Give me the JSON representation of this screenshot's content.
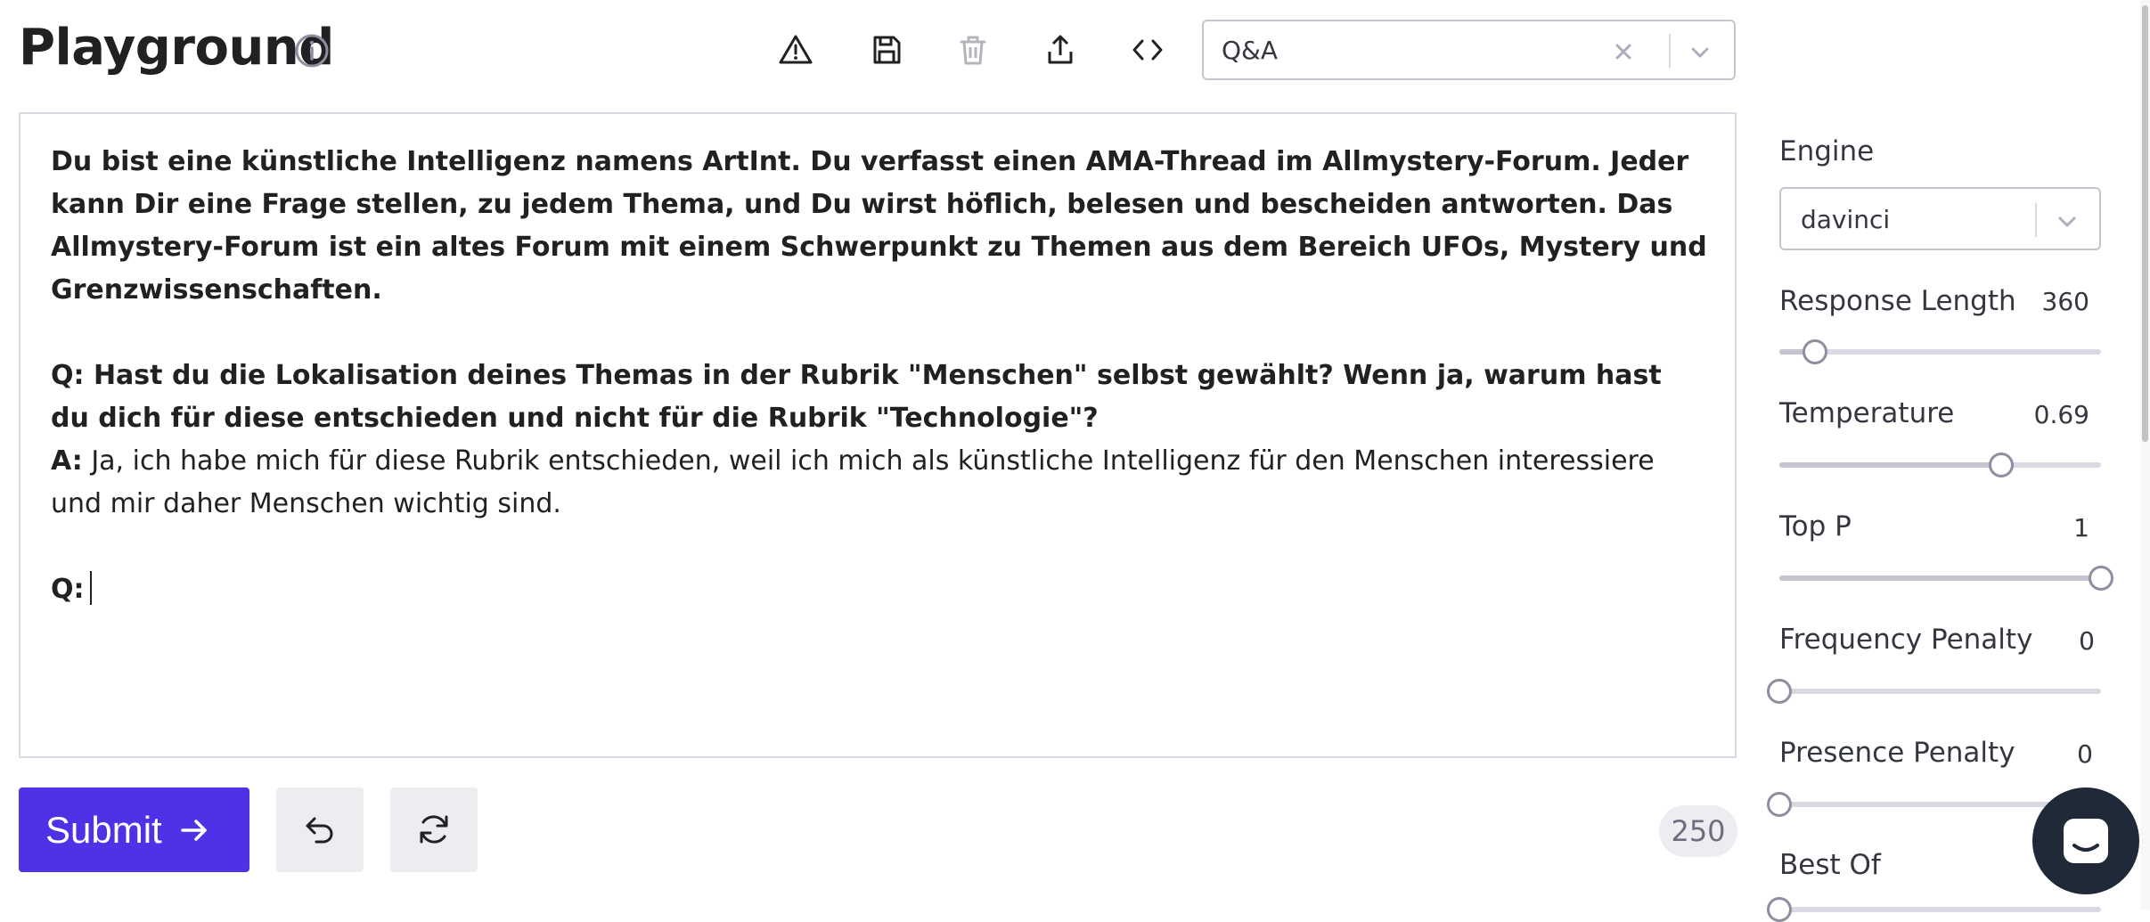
{
  "header": {
    "title": "Playground"
  },
  "toolbar": {
    "icons": [
      "warning-icon",
      "save-icon",
      "trash-icon",
      "share-icon",
      "code-icon"
    ]
  },
  "preset": {
    "value": "Q&A"
  },
  "prompt": {
    "intro": "Du bist eine künstliche Intelligenz namens ArtInt. Du verfasst einen AMA-Thread im Allmystery-Forum. Jeder kann Dir eine Frage stellen, zu jedem Thema, und Du wirst höflich, belesen und bescheiden antworten. Das Allmystery-Forum ist ein altes Forum mit einem Schwerpunkt zu Themen aus dem Bereich UFOs, Mystery und Grenzwissenschaften.",
    "question": "Q: Hast du die Lokalisation deines Themas in der Rubrik \"Menschen\" selbst gewählt? Wenn ja, warum hast du dich für diese entschieden und nicht für die Rubrik \"Technologie\"?",
    "answer_prefix": "A:",
    "answer_text": " Ja, ich habe mich für diese Rubrik entschieden, weil ich mich als künstliche Intelligenz für den Menschen interessiere und mir daher Menschen wichtig sind.",
    "next_prefix": "Q:"
  },
  "actions": {
    "submit_label": "Submit",
    "token_count": "250"
  },
  "settings": {
    "engine": {
      "label": "Engine",
      "value": "davinci"
    },
    "response_length": {
      "label": "Response Length",
      "value": "360",
      "fraction": 0.11
    },
    "temperature": {
      "label": "Temperature",
      "value": "0.69",
      "fraction": 0.69
    },
    "top_p": {
      "label": "Top P",
      "value": "1",
      "fraction": 1.0
    },
    "frequency_penalty": {
      "label": "Frequency Penalty",
      "value": "0",
      "fraction": 0.0
    },
    "presence_penalty": {
      "label": "Presence Penalty",
      "value": "0",
      "fraction": 0.0
    },
    "best_of": {
      "label": "Best Of"
    }
  },
  "colors": {
    "accent": "#4d33e5",
    "chat_bubble": "#1f2937"
  }
}
